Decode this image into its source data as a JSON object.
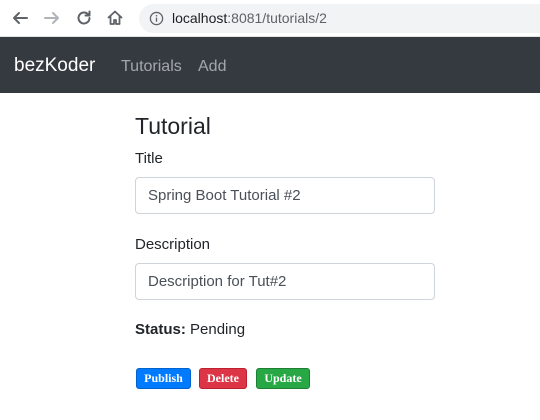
{
  "browser": {
    "url_host": "localhost",
    "url_rest": ":8081/tutorials/2",
    "icons": [
      "back-arrow-icon",
      "forward-arrow-icon",
      "reload-icon",
      "home-icon",
      "info-icon"
    ]
  },
  "navbar": {
    "brand": "bezKoder",
    "links": [
      "Tutorials",
      "Add"
    ]
  },
  "form": {
    "heading": "Tutorial",
    "title_label": "Title",
    "title_value": "Spring Boot Tutorial #2",
    "description_label": "Description",
    "description_value": "Description for Tut#2",
    "status_label": "Status:",
    "status_value": "Pending"
  },
  "buttons": {
    "publish": "Publish",
    "delete": "Delete",
    "update": "Update"
  },
  "colors": {
    "navbar": "#343a40",
    "publish": "#007bff",
    "delete": "#dc3545",
    "update": "#28a745"
  }
}
